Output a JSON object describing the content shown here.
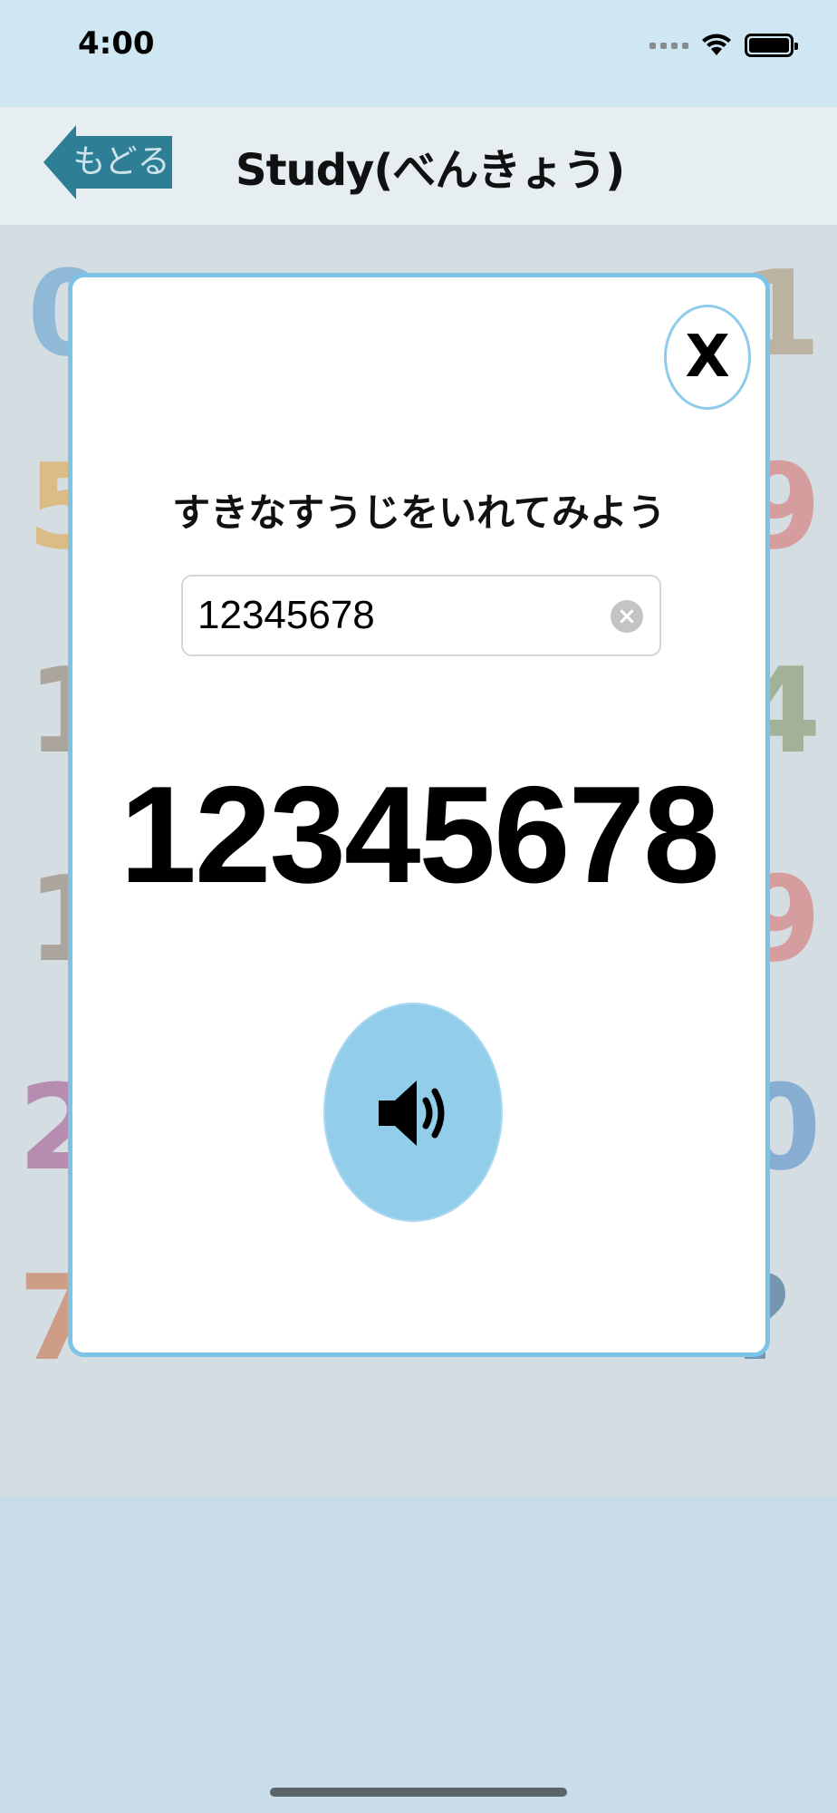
{
  "status_bar": {
    "time": "4:00"
  },
  "nav": {
    "back_label": "もどる",
    "title": "Study(べんきょう)"
  },
  "modal": {
    "close_label": "X",
    "prompt": "すきなすうじをいれてみよう",
    "number_input": {
      "value": "12345678",
      "placeholder": ""
    },
    "display_number": "12345678",
    "sound_icon": "speaker-icon"
  },
  "colors": {
    "accent": "#92cdea",
    "modal_border": "#7cc3e6",
    "back_button": "#2e7f96"
  }
}
